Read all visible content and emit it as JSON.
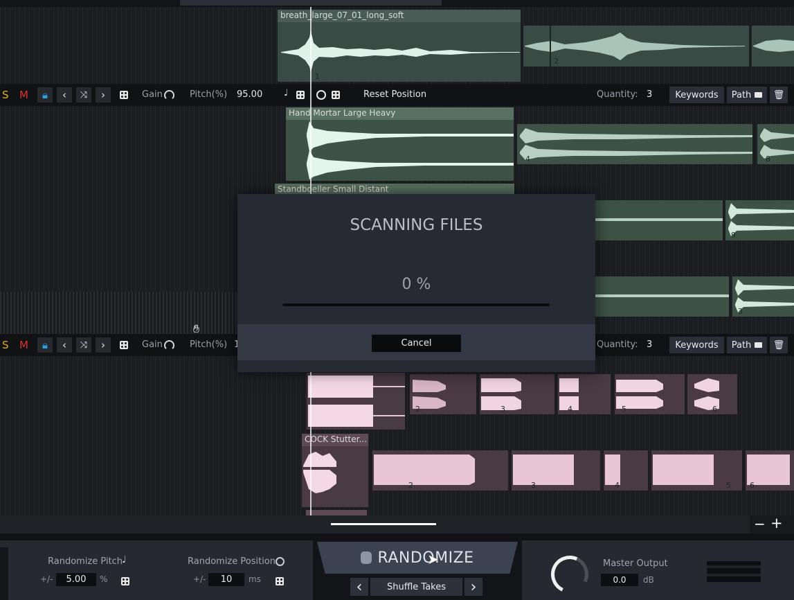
{
  "tracks": [
    {
      "clips": [
        {
          "name": "breath_large_07_01_long_soft",
          "number": "1"
        },
        {
          "name": "",
          "number": "2"
        }
      ],
      "controls": {
        "solo": "S",
        "mute": "M",
        "gain_label": "Gain",
        "pitch_label": "Pitch(%)",
        "pitch_value": "95.00",
        "reset_label": "Reset Position",
        "quantity_label": "Quantity:",
        "quantity_value": "3",
        "keywords_label": "Keywords",
        "path_label": "Path"
      }
    },
    {
      "clips": [
        {
          "name": "Hand Mortar Large Heavy",
          "number": ""
        },
        {
          "name": "",
          "number": "4"
        },
        {
          "name": "",
          "number": "8"
        },
        {
          "name": "Standboeller Small Distant",
          "number": ""
        },
        {
          "name": "",
          "number": "9"
        },
        {
          "name": "",
          "number": "3"
        }
      ],
      "controls": {
        "solo": "S",
        "mute": "M",
        "gain_label": "Gain",
        "pitch_label": "Pitch(%)",
        "pitch_value": "1",
        "quantity_label": "Quantity:",
        "quantity_value": "3",
        "keywords_label": "Keywords",
        "path_label": "Path"
      }
    },
    {
      "clips": [
        {
          "name": "",
          "number": "2"
        },
        {
          "name": "",
          "number": "3"
        },
        {
          "name": "",
          "number": "4"
        },
        {
          "name": "",
          "number": "5"
        },
        {
          "name": "",
          "number": "6"
        },
        {
          "name": "COCK Stutter...",
          "number": ""
        },
        {
          "name": "",
          "number": "2"
        },
        {
          "name": "",
          "number": "3"
        },
        {
          "name": "",
          "number": "4"
        },
        {
          "name": "",
          "number": "5"
        },
        {
          "name": "",
          "number": "6"
        }
      ]
    }
  ],
  "modal": {
    "title": "SCANNING FILES",
    "progress_text": "0 %",
    "progress": 0,
    "cancel_label": "Cancel"
  },
  "zoom": {
    "minus": "−",
    "plus": "+"
  },
  "bottom": {
    "randomize_pitch_label": "Randomize Pitch",
    "pitch_prefix": "+/-",
    "pitch_value": "5.00",
    "pitch_unit": "%",
    "randomize_position_label": "Randomize Position",
    "position_prefix": "+/-",
    "position_value": "10",
    "position_unit": "ms",
    "randomize_label": "RANDOMIZE",
    "mode_label": "Shuffle Takes",
    "master_label": "Master Output",
    "master_value": "0.0",
    "master_unit": "dB"
  },
  "colors": {
    "solo": "#e0b020",
    "mute": "#e03030",
    "lock": "#2aa0e0",
    "wave_green": "#d8f0e0",
    "wave_pink": "#f0d4e0"
  }
}
